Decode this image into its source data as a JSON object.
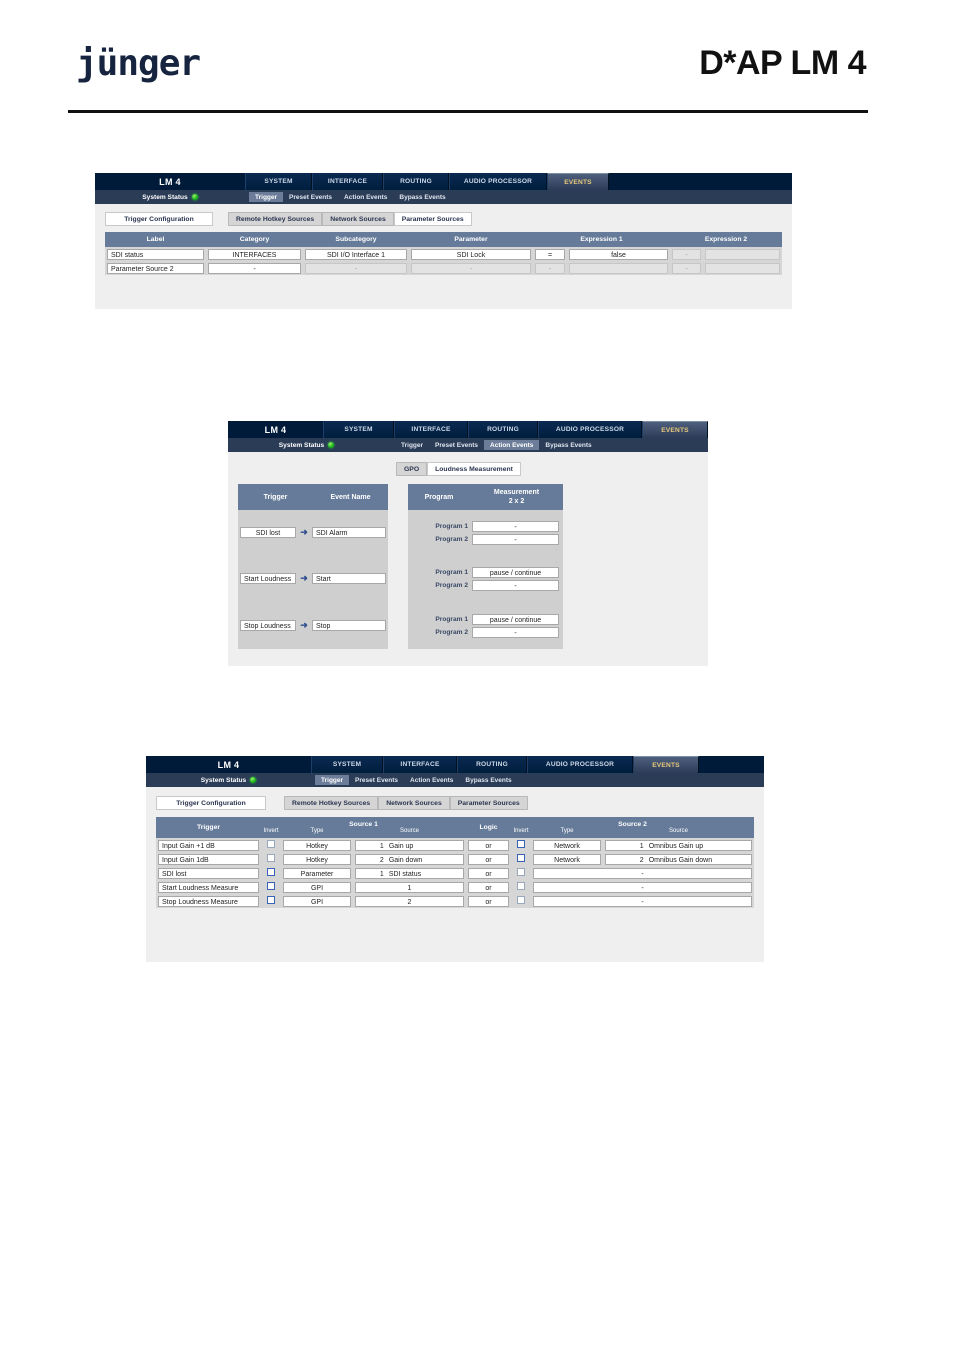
{
  "page": {
    "logo": "jünger",
    "title": "D*AP LM 4"
  },
  "panel1": {
    "brand": "LM 4",
    "status_label": "System Status",
    "nav_tabs": [
      {
        "label": "SYSTEM",
        "active": false
      },
      {
        "label": "INTERFACE",
        "active": false
      },
      {
        "label": "ROUTING",
        "active": false
      },
      {
        "label": "AUDIO PROCESSOR",
        "active": false
      },
      {
        "label": "EVENTS",
        "active": true
      }
    ],
    "sub_tabs": [
      {
        "label": "Trigger",
        "active": true
      },
      {
        "label": "Preset Events",
        "active": false
      },
      {
        "label": "Action Events",
        "active": false
      },
      {
        "label": "Bypass Events",
        "active": false
      }
    ],
    "left_tab": "Trigger Configuration",
    "source_tabs": [
      {
        "label": "Remote Hotkey Sources",
        "active": false
      },
      {
        "label": "Network Sources",
        "active": false
      },
      {
        "label": "Parameter Sources",
        "active": true
      }
    ],
    "columns": [
      "Label",
      "Category",
      "Subcategory",
      "Parameter",
      "Expression 1",
      "Expression 2"
    ],
    "rows": [
      {
        "label": "SDI status",
        "category": "INTERFACES",
        "subcategory": "SDI I/O Interface 1",
        "parameter": "SDI Lock",
        "operator1": "=",
        "expression1": "false",
        "operator2": "-",
        "expression2": "",
        "disabled": false
      },
      {
        "label": "Parameter Source 2",
        "category": "-",
        "subcategory": "-",
        "parameter": "-",
        "operator1": "-",
        "expression1": "",
        "operator2": "-",
        "expression2": "",
        "disabled": true
      }
    ]
  },
  "panel2": {
    "brand": "LM 4",
    "status_label": "System Status",
    "nav_tabs": [
      {
        "label": "SYSTEM",
        "active": false
      },
      {
        "label": "INTERFACE",
        "active": false
      },
      {
        "label": "ROUTING",
        "active": false
      },
      {
        "label": "AUDIO PROCESSOR",
        "active": false
      },
      {
        "label": "EVENTS",
        "active": true
      }
    ],
    "sub_tabs": [
      {
        "label": "Trigger",
        "active": false
      },
      {
        "label": "Preset Events",
        "active": false
      },
      {
        "label": "Action Events",
        "active": true
      },
      {
        "label": "Bypass Events",
        "active": false
      }
    ],
    "mode_tabs": [
      {
        "label": "GPO",
        "active": false
      },
      {
        "label": "Loudness Measurement",
        "active": true
      }
    ],
    "left_table": {
      "columns": [
        "Trigger",
        "Event Name"
      ],
      "rows": [
        {
          "trigger": "SDI lost",
          "event_name": "SDI Alarm"
        },
        {
          "trigger": "Start Loudness",
          "event_name": "Start"
        },
        {
          "trigger": "Stop Loudness",
          "event_name": "Stop"
        }
      ]
    },
    "right_table": {
      "col_program": "Program",
      "col_measurement": "Measurement",
      "col_measurement_sub": "2 x 2",
      "groups": [
        {
          "rows": [
            {
              "program": "Program 1",
              "value": "-"
            },
            {
              "program": "Program 2",
              "value": "-"
            }
          ]
        },
        {
          "rows": [
            {
              "program": "Program 1",
              "value": "pause / continue"
            },
            {
              "program": "Program 2",
              "value": "-"
            }
          ]
        },
        {
          "rows": [
            {
              "program": "Program 1",
              "value": "pause / continue"
            },
            {
              "program": "Program 2",
              "value": "-"
            }
          ]
        }
      ]
    }
  },
  "panel3": {
    "brand": "LM 4",
    "status_label": "System Status",
    "nav_tabs": [
      {
        "label": "SYSTEM",
        "active": false
      },
      {
        "label": "INTERFACE",
        "active": false
      },
      {
        "label": "ROUTING",
        "active": false
      },
      {
        "label": "AUDIO PROCESSOR",
        "active": false
      },
      {
        "label": "EVENTS",
        "active": true
      }
    ],
    "sub_tabs": [
      {
        "label": "Trigger",
        "active": true
      },
      {
        "label": "Preset Events",
        "active": false
      },
      {
        "label": "Action Events",
        "active": false
      },
      {
        "label": "Bypass Events",
        "active": false
      }
    ],
    "left_tab": "Trigger Configuration",
    "source_tabs": [
      {
        "label": "Remote Hotkey Sources",
        "active": false
      },
      {
        "label": "Network Sources",
        "active": false
      },
      {
        "label": "Parameter Sources",
        "active": false
      }
    ],
    "columns": {
      "trigger": "Trigger",
      "invert1": "Invert",
      "type1": "Type",
      "source1_group": "Source 1",
      "source1": "Source",
      "logic": "Logic",
      "invert2": "Invert",
      "type2": "Type",
      "source2_group": "Source 2",
      "source2": "Source"
    },
    "rows": [
      {
        "trigger": "Input Gain +1 dB",
        "invert1": false,
        "invert1_blue": false,
        "type1": "Hotkey",
        "src1_num": "1",
        "src1_name": "Gain up",
        "logic": "or",
        "invert2": false,
        "invert2_blue": true,
        "type2": "Network",
        "src2_num": "1",
        "src2_name": "Omnibus Gain up",
        "src2_empty": false
      },
      {
        "trigger": "Input Gain 1dB",
        "invert1": false,
        "invert1_blue": false,
        "type1": "Hotkey",
        "src1_num": "2",
        "src1_name": "Gain down",
        "logic": "or",
        "invert2": false,
        "invert2_blue": true,
        "type2": "Network",
        "src2_num": "2",
        "src2_name": "Omnibus Gain down",
        "src2_empty": false
      },
      {
        "trigger": "SDI lost",
        "invert1": false,
        "invert1_blue": true,
        "type1": "Parameter",
        "src1_num": "1",
        "src1_name": "SDI status",
        "logic": "or",
        "invert2": false,
        "invert2_blue": false,
        "type2": "",
        "src2_num": "",
        "src2_name": "-",
        "src2_empty": true
      },
      {
        "trigger": "Start Loudness Measure",
        "invert1": false,
        "invert1_blue": true,
        "type1": "GPI",
        "src1_num": "",
        "src1_name": "1",
        "logic": "or",
        "invert2": false,
        "invert2_blue": false,
        "type2": "",
        "src2_num": "",
        "src2_name": "-",
        "src2_empty": true
      },
      {
        "trigger": "Stop Loudness Measure",
        "invert1": false,
        "invert1_blue": true,
        "type1": "GPI",
        "src1_num": "",
        "src1_name": "2",
        "logic": "or",
        "invert2": false,
        "invert2_blue": false,
        "type2": "",
        "src2_num": "",
        "src2_name": "-",
        "src2_empty": true
      }
    ]
  },
  "colors": {
    "navbar": "#001b3a",
    "subnav": "#2b3c56",
    "table_header": "#667b99",
    "panel_bg": "#efefef",
    "row_bg": "#d6d6d6",
    "active_tab_text": "#e8c87a",
    "status_led": "#22c424"
  }
}
